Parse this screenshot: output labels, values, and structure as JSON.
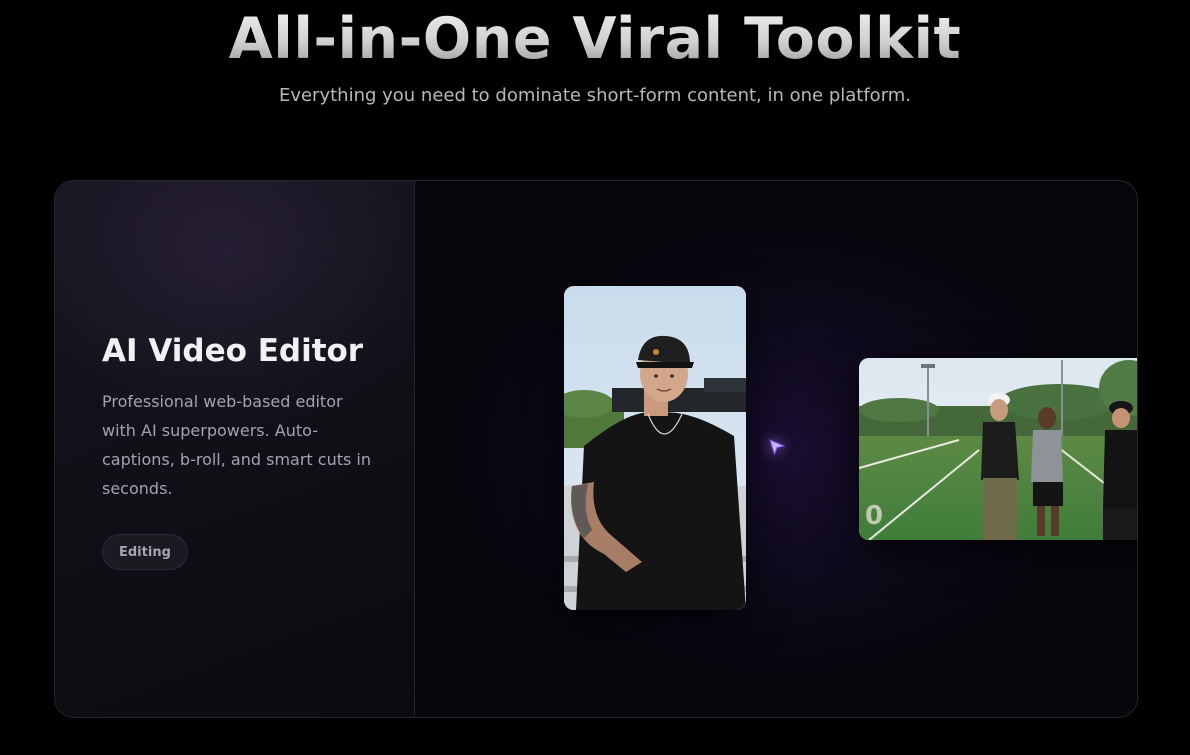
{
  "hero": {
    "title": "All-in-One Viral Toolkit",
    "subtitle": "Everything you need to dominate short-form content, in one platform."
  },
  "feature": {
    "title": "AI Video Editor",
    "description": "Professional web-based editor with AI superpowers. Auto-captions, b-roll, and smart cuts in seconds.",
    "tag": "Editing"
  },
  "visual": {
    "clips": [
      {
        "kind": "portrait",
        "name": "video-thumbnail-portrait"
      },
      {
        "kind": "landscape",
        "name": "video-thumbnail-landscape"
      }
    ],
    "cursor_icon": "pointer-cursor-icon"
  },
  "colors": {
    "background": "#000000",
    "card_border": "#27262d",
    "accent_cursor": "#a37cff",
    "text_primary": "#f1f1f3",
    "text_secondary": "#a4a3ab"
  }
}
